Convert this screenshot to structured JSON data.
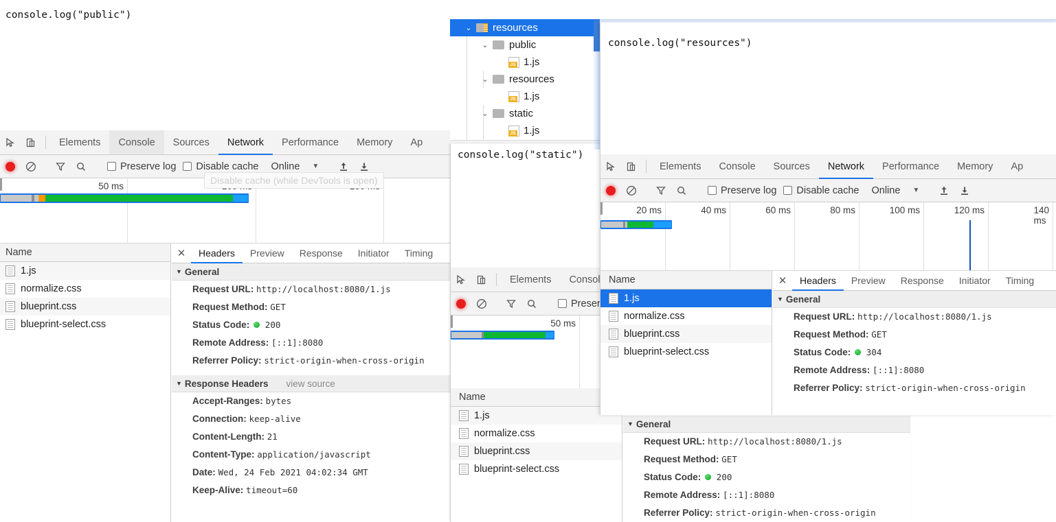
{
  "editors": {
    "public": {
      "code": "console.log(\"public\")"
    },
    "resources": {
      "code": "console.log(\"resources\")"
    },
    "static": {
      "code": "console.log(\"static\")"
    }
  },
  "file_tree": {
    "nodes": [
      {
        "label": "resources",
        "type": "folder-root",
        "depth": 0,
        "expanded": true,
        "selected": true,
        "icon": "folder-resources-icon"
      },
      {
        "label": "public",
        "type": "folder",
        "depth": 1,
        "expanded": true,
        "selected": false,
        "icon": "folder-icon"
      },
      {
        "label": "1.js",
        "type": "file-js",
        "depth": 2,
        "expanded": false,
        "selected": false,
        "icon": "js-file-icon"
      },
      {
        "label": "resources",
        "type": "folder",
        "depth": 1,
        "expanded": true,
        "selected": false,
        "icon": "folder-icon"
      },
      {
        "label": "1.js",
        "type": "file-js",
        "depth": 2,
        "expanded": false,
        "selected": false,
        "icon": "js-file-icon"
      },
      {
        "label": "static",
        "type": "folder",
        "depth": 1,
        "expanded": true,
        "selected": false,
        "icon": "folder-icon"
      },
      {
        "label": "1.js",
        "type": "file-js",
        "depth": 2,
        "expanded": false,
        "selected": false,
        "icon": "js-file-icon"
      }
    ]
  },
  "devtools": {
    "main_tabs": [
      "Elements",
      "Console",
      "Sources",
      "Network",
      "Performance",
      "Memory",
      "Ap"
    ],
    "active_main_tab": "Network",
    "hover_main_tab": "Console",
    "toolbar": {
      "record_label": "record-button",
      "clear_label": "clear-button",
      "filter_label": "filter-button",
      "search_label": "search-button",
      "preserve_log": "Preserve log",
      "disable_cache": "Disable cache",
      "throttle": "Online",
      "preserve_log_checked": false,
      "disable_cache_checked": false
    },
    "tooltip": "Disable cache (while DevTools is open)",
    "detail_tabs": [
      "Headers",
      "Preview",
      "Response",
      "Initiator",
      "Timing"
    ],
    "active_detail_tab": "Headers",
    "name_column_header": "Name",
    "requests": [
      "1.js",
      "normalize.css",
      "blueprint.css",
      "blueprint-select.css"
    ],
    "section_general": "General",
    "section_response_headers": "Response Headers",
    "view_source": "view source"
  },
  "panel1": {
    "timeline_ticks": [
      "50 ms",
      "100 ms",
      "150 ms"
    ],
    "selected_request_index": 0,
    "general": {
      "request_url_key": "Request URL:",
      "request_url": "http://localhost:8080/1.js",
      "request_method_key": "Request Method:",
      "request_method": "GET",
      "status_code_key": "Status Code:",
      "status_code": "200",
      "remote_address_key": "Remote Address:",
      "remote_address": "[::1]:8080",
      "referrer_policy_key": "Referrer Policy:",
      "referrer_policy": "strict-origin-when-cross-origin"
    },
    "response_headers": [
      {
        "key": "Accept-Ranges:",
        "value": "bytes"
      },
      {
        "key": "Connection:",
        "value": "keep-alive"
      },
      {
        "key": "Content-Length:",
        "value": "21"
      },
      {
        "key": "Content-Type:",
        "value": "application/javascript"
      },
      {
        "key": "Date:",
        "value": "Wed, 24 Feb 2021 04:02:34 GMT"
      },
      {
        "key": "Keep-Alive:",
        "value": "timeout=60"
      }
    ]
  },
  "panel2": {
    "timeline_ticks": [
      "20 ms",
      "40 ms",
      "60 ms",
      "80 ms",
      "100 ms",
      "120 ms",
      "140 ms"
    ],
    "selected_request_index": 0,
    "general": {
      "request_url_key": "Request URL:",
      "request_url": "http://localhost:8080/1.js",
      "request_method_key": "Request Method:",
      "request_method": "GET",
      "status_code_key": "Status Code:",
      "status_code": "304",
      "remote_address_key": "Remote Address:",
      "remote_address": "[::1]:8080",
      "referrer_policy_key": "Referrer Policy:",
      "referrer_policy": "strict-origin-when-cross-origin"
    }
  },
  "panel3": {
    "timeline_ticks": [
      "50 ms"
    ],
    "selected_request_index": 0,
    "general": {
      "request_url_key": "Request URL:",
      "request_url": "http://localhost:8080/1.js",
      "request_method_key": "Request Method:",
      "request_method": "GET",
      "status_code_key": "Status Code:",
      "status_code": "200",
      "remote_address_key": "Remote Address:",
      "remote_address": "[::1]:8080",
      "referrer_policy_key": "Referrer Policy:",
      "referrer_policy": "strict-origin-when-cross-origin"
    }
  },
  "colors": {
    "accent": "#1a73e8",
    "record": "#e81d1d",
    "waterfall_green": "#0fb832",
    "waterfall_blue": "#1a9ffb",
    "waterfall_grey": "#c8c8c8",
    "waterfall_orange": "#ff9800",
    "status_ok": "#0a9c27"
  }
}
